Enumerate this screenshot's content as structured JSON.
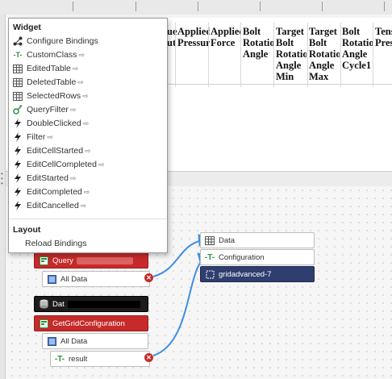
{
  "grid": {
    "headers": [
      {
        "text": "ue\nut"
      },
      {
        "text": "Applied\nPressur"
      },
      {
        "text": "Applied\nForce"
      },
      {
        "text": "Bolt\nRotatio\nAngle"
      },
      {
        "text": "Target\nBolt\nRotatio\nAngle\nMin"
      },
      {
        "text": "Target\nBolt\nRotatio\nAngle\nMax"
      },
      {
        "text": "Bolt\nRotatio\nAngle\nCycle1"
      },
      {
        "text": "Tens\nPres"
      }
    ]
  },
  "menu": {
    "widget_section": "Widget",
    "items": [
      {
        "label": "Configure Bindings",
        "icon": "configure-bindings-icon",
        "arrow": false
      },
      {
        "label": "CustomClass",
        "icon": "text-property-icon",
        "arrow": true
      },
      {
        "label": "EditedTable",
        "icon": "table-icon",
        "arrow": true
      },
      {
        "label": "DeletedTable",
        "icon": "table-icon",
        "arrow": true
      },
      {
        "label": "SelectedRows",
        "icon": "table-icon",
        "arrow": true
      },
      {
        "label": "QueryFilter",
        "icon": "query-filter-icon",
        "arrow": true
      },
      {
        "label": "DoubleClicked",
        "icon": "lightning-icon",
        "arrow": true
      },
      {
        "label": "Filter",
        "icon": "lightning-icon",
        "arrow": true
      },
      {
        "label": "EditCellStarted",
        "icon": "lightning-icon",
        "arrow": true
      },
      {
        "label": "EditCellCompleted",
        "icon": "lightning-icon",
        "arrow": true
      },
      {
        "label": "EditStarted",
        "icon": "lightning-icon",
        "arrow": true
      },
      {
        "label": "EditCompleted",
        "icon": "lightning-icon",
        "arrow": true
      },
      {
        "label": "EditCancelled",
        "icon": "lightning-icon",
        "arrow": true
      }
    ],
    "arrow_glyph": "⇨",
    "layout_section": "Layout",
    "reload_bindings": "Reload Bindings"
  },
  "nodes": {
    "query_service": "Query",
    "query_all_data": "All Data",
    "datasource": "Dat",
    "get_grid_config": "GetGridConfiguration",
    "get_grid_all_data": "All Data",
    "result": "result",
    "target_data": "Data",
    "target_configuration": "Configuration",
    "target_widget": "gridadvanced-7"
  },
  "colors": {
    "service_red": "#c62a2a",
    "widget_navy": "#2f3e6e",
    "link_blue": "#3f8fe0"
  }
}
